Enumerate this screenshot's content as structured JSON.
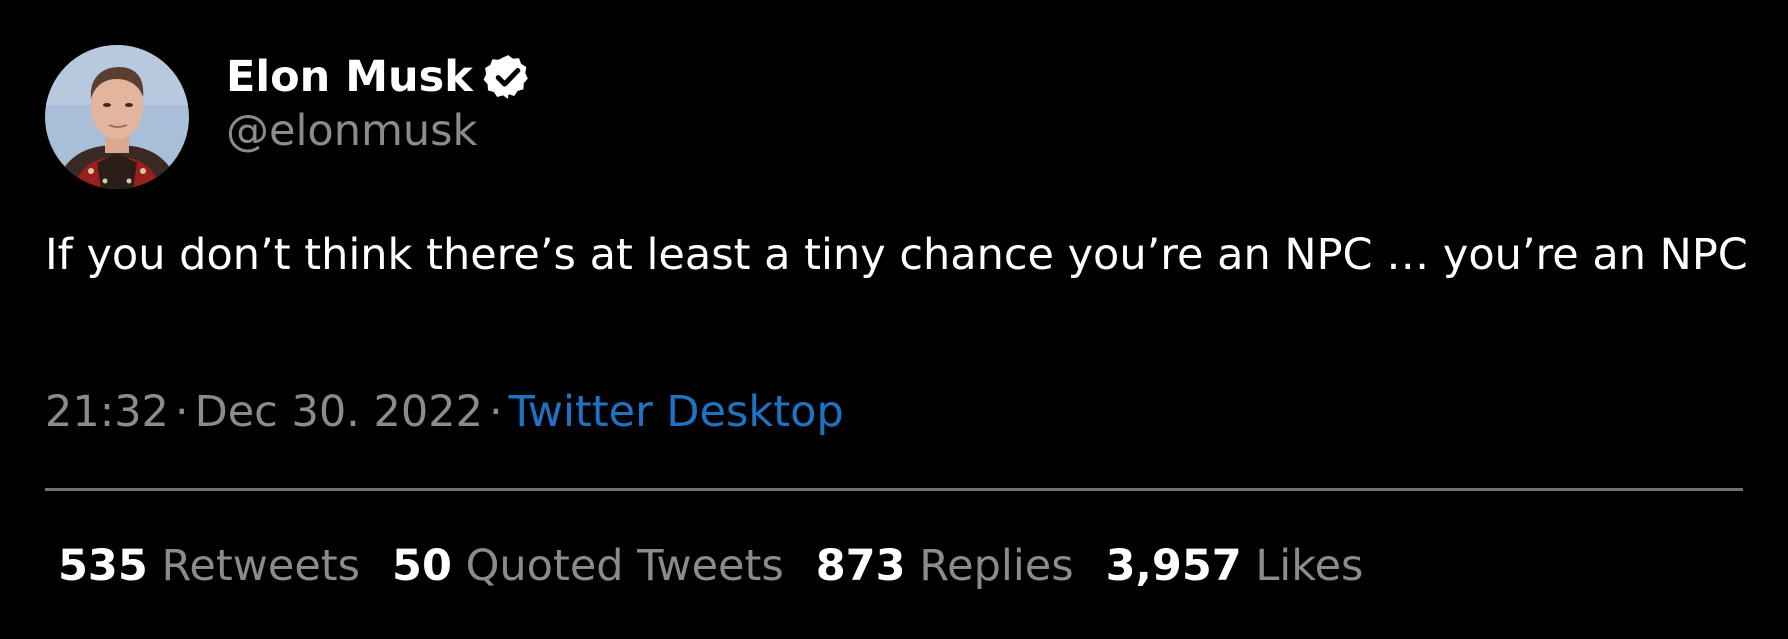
{
  "author": {
    "display_name": "Elon Musk",
    "handle": "@elonmusk",
    "verified_icon": "verified-badge-icon",
    "avatar_icon": "profile-photo"
  },
  "tweet": {
    "text": "If you don’t think there’s at least a tiny chance you’re an NPC … you’re an NPC"
  },
  "meta": {
    "time": "21:32",
    "separator": "·",
    "date": "Dec 30. 2022",
    "source": "Twitter Desktop"
  },
  "stats": [
    {
      "count": "535",
      "label": "Retweets"
    },
    {
      "count": "50",
      "label": "Quoted Tweets"
    },
    {
      "count": "873",
      "label": "Replies"
    },
    {
      "count": "3,957",
      "label": "Likes"
    }
  ],
  "colors": {
    "background": "#000000",
    "primary_text": "#ffffff",
    "secondary_text": "#8b8b8b",
    "link": "#1d74c6",
    "divider": "#727272"
  }
}
